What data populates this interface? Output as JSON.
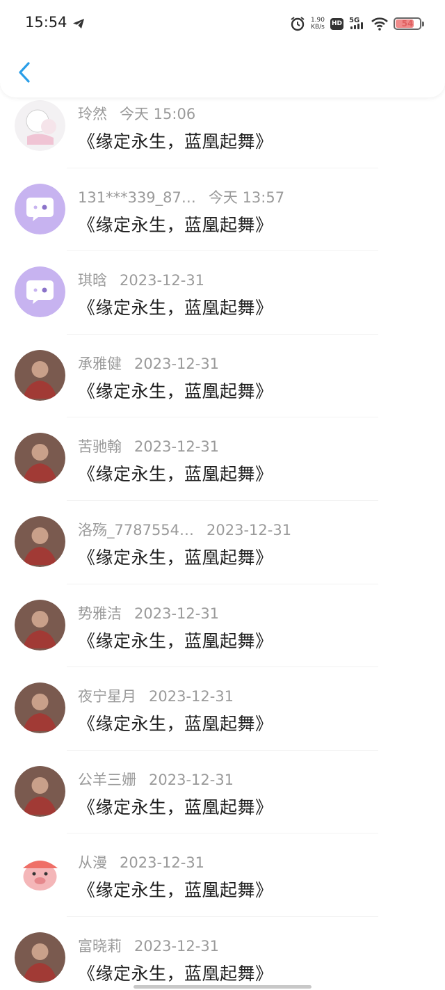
{
  "status_bar": {
    "time": "15:54",
    "net_speed_value": "1.90",
    "net_speed_unit": "KB/s",
    "hd_label": "HD",
    "network_label": "5G",
    "battery_level": "54",
    "icons": [
      "telegram-icon",
      "alarm-icon",
      "hd-icon",
      "signal-icon",
      "wifi-icon",
      "battery-icon"
    ]
  },
  "header": {
    "back_icon": "chevron-left-icon",
    "accent": "#2a9ee8"
  },
  "comments": [
    {
      "name": "玲然",
      "time": "今天  15:06",
      "message": "《缘定永生，蓝凰起舞》",
      "avatar": "anime-girl-avatar"
    },
    {
      "name": "131***339_87…",
      "time": "今天  13:57",
      "message": "《缘定永生，蓝凰起舞》",
      "avatar": "default-chat-avatar"
    },
    {
      "name": "琪晗",
      "time": "2023-12-31",
      "message": "《缘定永生，蓝凰起舞》",
      "avatar": "default-chat-avatar"
    },
    {
      "name": "承雅健",
      "time": "2023-12-31",
      "message": "《缘定永生，蓝凰起舞》",
      "avatar": "photo-avatar"
    },
    {
      "name": "苦驰翰",
      "time": "2023-12-31",
      "message": "《缘定永生，蓝凰起舞》",
      "avatar": "photo-avatar"
    },
    {
      "name": "洛殇_7787554…",
      "time": "2023-12-31",
      "message": "《缘定永生，蓝凰起舞》",
      "avatar": "photo-avatar"
    },
    {
      "name": "势雅洁",
      "time": "2023-12-31",
      "message": "《缘定永生，蓝凰起舞》",
      "avatar": "photo-avatar"
    },
    {
      "name": "夜宁星月",
      "time": "2023-12-31",
      "message": "《缘定永生，蓝凰起舞》",
      "avatar": "photo-avatar"
    },
    {
      "name": "公羊三姗",
      "time": "2023-12-31",
      "message": "《缘定永生，蓝凰起舞》",
      "avatar": "photo-avatar"
    },
    {
      "name": "从漫",
      "time": "2023-12-31",
      "message": "《缘定永生，蓝凰起舞》",
      "avatar": "pig-avatar"
    },
    {
      "name": "富晓莉",
      "time": "2023-12-31",
      "message": "《缘定永生，蓝凰起舞》",
      "avatar": "photo-avatar"
    }
  ]
}
